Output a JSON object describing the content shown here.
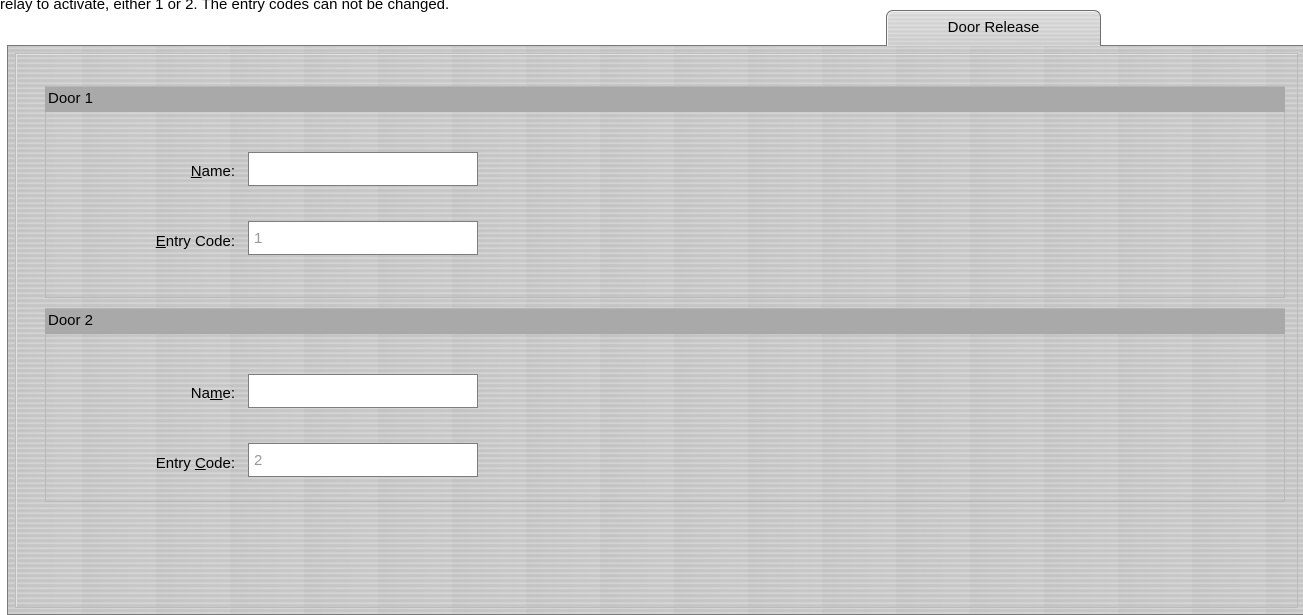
{
  "intro": {
    "text": "relay to activate, either 1 or 2. The entry codes can not be changed."
  },
  "tab": {
    "label": "Door Release"
  },
  "door1": {
    "header": "Door 1",
    "name_label_pre": "",
    "name_label_mnemonic": "N",
    "name_label_post": "ame:",
    "name_value": "",
    "entry_label_pre": "",
    "entry_label_mnemonic": "E",
    "entry_label_post": "ntry Code:",
    "entry_value": "1"
  },
  "door2": {
    "header": "Door 2",
    "name_label_pre": "Na",
    "name_label_mnemonic": "m",
    "name_label_post": "e:",
    "name_value": "",
    "entry_label_pre": "Entry ",
    "entry_label_mnemonic": "C",
    "entry_label_post": "ode:",
    "entry_value": "2"
  }
}
